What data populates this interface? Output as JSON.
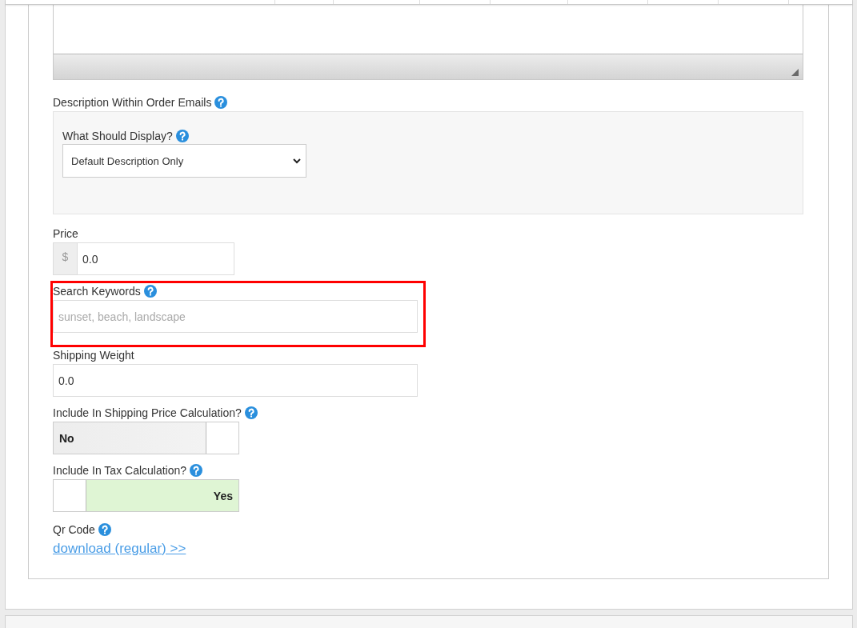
{
  "fields": [
    {
      "kind": "group",
      "label": "Description Within Order Emails",
      "help": true,
      "highlighted": false,
      "select": {
        "label": "What Should Display?",
        "help": true,
        "value": "Default Description Only"
      }
    },
    {
      "kind": "money",
      "label": "Price",
      "help": false,
      "highlighted": false,
      "prefix": "$",
      "value": "0.0"
    },
    {
      "kind": "text",
      "label": "Search Keywords",
      "help": true,
      "highlighted": true,
      "placeholder": "sunset, beach, landscape"
    },
    {
      "kind": "text",
      "label": "Shipping Weight",
      "help": false,
      "highlighted": false,
      "value": "0.0"
    },
    {
      "kind": "toggle",
      "label": "Include In Shipping Price Calculation?",
      "help": true,
      "highlighted": false,
      "on": false,
      "text": "No"
    },
    {
      "kind": "toggle",
      "label": "Include In Tax Calculation?",
      "help": true,
      "highlighted": false,
      "on": true,
      "text": "Yes"
    },
    {
      "kind": "link",
      "label": "Qr Code",
      "help": true,
      "highlighted": false,
      "link": "download (regular) >>"
    }
  ]
}
